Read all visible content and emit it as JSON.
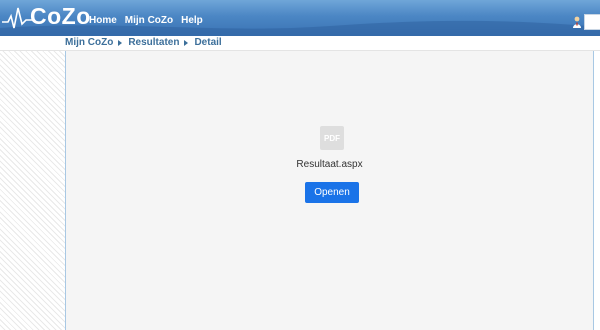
{
  "header": {
    "logo_text": "CoZo",
    "nav": [
      "Home",
      "Mijn CoZo",
      "Help"
    ]
  },
  "breadcrumb": {
    "items": [
      "Mijn CoZo",
      "Resultaten"
    ],
    "current": "Detail"
  },
  "document": {
    "icon_label": "PDF",
    "filename": "Resultaat.aspx",
    "open_label": "Openen"
  },
  "colors": {
    "header": "#4b86c4",
    "breadcrumb_text": "#3c6f9a",
    "button": "#1a73e8",
    "main_bg": "#f5f5f5"
  },
  "icons": [
    "heartbeat-logo-icon",
    "user-icon",
    "chevron-right-icon",
    "pdf-icon"
  ]
}
